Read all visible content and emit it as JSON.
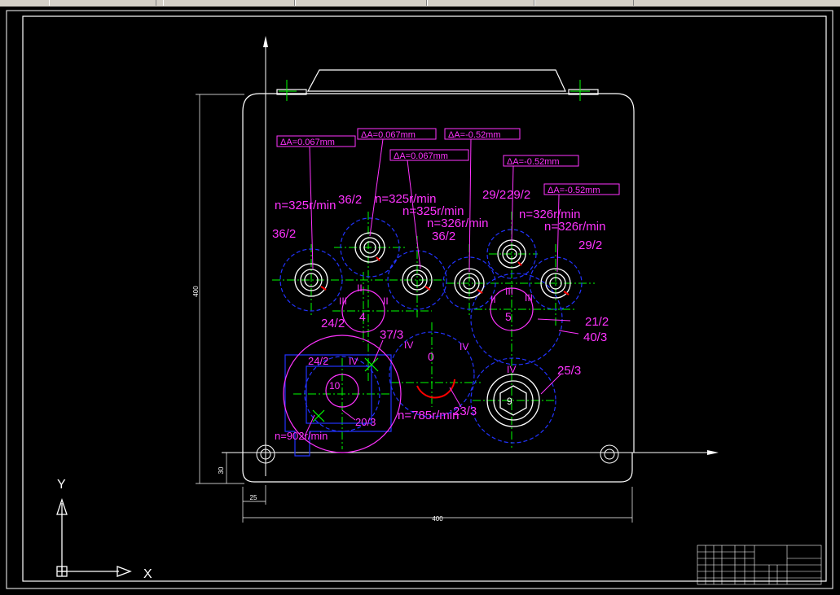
{
  "window": {
    "tabs": [
      "",
      "",
      "",
      "",
      "",
      "",
      ""
    ]
  },
  "drawing": {
    "dimensions": {
      "overall_width": "400",
      "overall_height": "400",
      "bottom_offset": "30",
      "left_offset": "25"
    },
    "tolerances": [
      "ΔA=0.067mm",
      "ΔA=0.067mm",
      "ΔA=0.067mm",
      "ΔA=-0.52mm",
      "ΔA=-0.52mm",
      "ΔA=-0.52mm"
    ],
    "speed_labels": [
      "n=325r/min",
      "n=325r/min",
      "n=325r/min",
      "n=326r/min",
      "n=326r/min",
      "n=326r/min",
      "n=785r/min",
      "n=902r/min"
    ],
    "gear_labels": [
      "36/2",
      "36/2",
      "36/2",
      "29/2",
      "29/2",
      "29/2",
      "24/2",
      "37/3",
      "21/2",
      "40/3",
      "25/3",
      "23/3",
      "24/2",
      "20/3"
    ],
    "roman_labels": [
      "II",
      "III",
      "II",
      "III",
      "II",
      "III",
      "IV",
      "IV",
      "IV",
      "IV"
    ],
    "shaft_numbers": [
      "4",
      "5",
      "0",
      "10",
      "9"
    ],
    "ucs": {
      "x_label": "X",
      "y_label": "Y"
    }
  }
}
